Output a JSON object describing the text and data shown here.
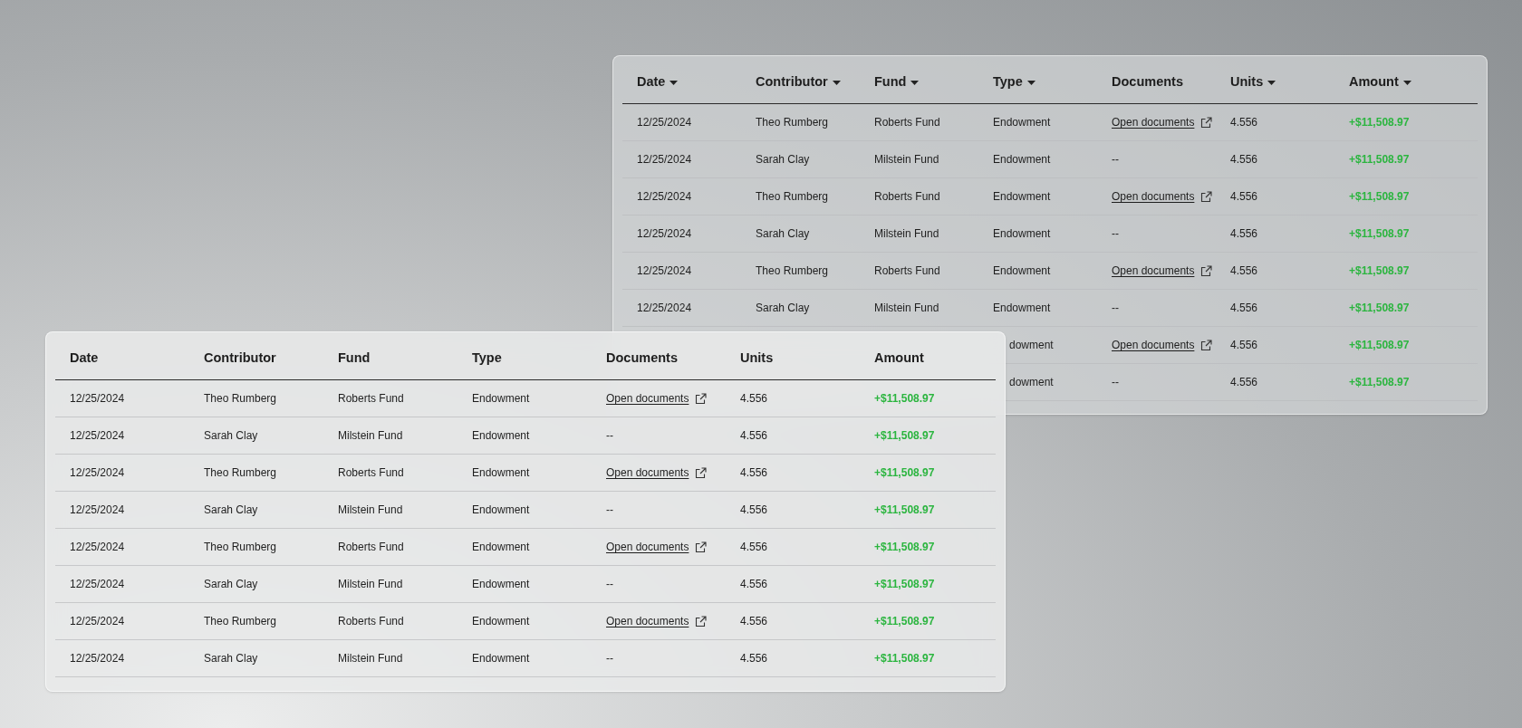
{
  "tables": [
    {
      "columns": [
        {
          "label": "Date",
          "sortable": true
        },
        {
          "label": "Contributor",
          "sortable": true
        },
        {
          "label": "Fund",
          "sortable": true
        },
        {
          "label": "Type",
          "sortable": true
        },
        {
          "label": "Documents",
          "sortable": false
        },
        {
          "label": "Units",
          "sortable": true
        },
        {
          "label": "Amount",
          "sortable": true
        }
      ],
      "rows": [
        {
          "covered": false,
          "date": "12/25/2024",
          "contributor": "Theo Rumberg",
          "fund": "Roberts Fund",
          "type": "Endowment",
          "documents": {
            "kind": "link",
            "text": "Open documents"
          },
          "units": "4.556",
          "amount": "+$11,508.97"
        },
        {
          "covered": false,
          "date": "12/25/2024",
          "contributor": "Sarah Clay",
          "fund": "Milstein Fund",
          "type": "Endowment",
          "documents": {
            "kind": "text",
            "text": "--"
          },
          "units": "4.556",
          "amount": "+$11,508.97"
        },
        {
          "covered": false,
          "date": "12/25/2024",
          "contributor": "Theo Rumberg",
          "fund": "Roberts Fund",
          "type": "Endowment",
          "documents": {
            "kind": "link",
            "text": "Open documents"
          },
          "units": "4.556",
          "amount": "+$11,508.97"
        },
        {
          "covered": false,
          "date": "12/25/2024",
          "contributor": "Sarah Clay",
          "fund": "Milstein Fund",
          "type": "Endowment",
          "documents": {
            "kind": "text",
            "text": "--"
          },
          "units": "4.556",
          "amount": "+$11,508.97"
        },
        {
          "covered": false,
          "date": "12/25/2024",
          "contributor": "Theo Rumberg",
          "fund": "Roberts Fund",
          "type": "Endowment",
          "documents": {
            "kind": "link",
            "text": "Open documents"
          },
          "units": "4.556",
          "amount": "+$11,508.97"
        },
        {
          "covered": false,
          "date": "12/25/2024",
          "contributor": "Sarah Clay",
          "fund": "Milstein Fund",
          "type": "Endowment",
          "documents": {
            "kind": "text",
            "text": "--"
          },
          "units": "4.556",
          "amount": "+$11,508.97"
        },
        {
          "covered": true,
          "type": "dowment",
          "documents": {
            "kind": "link",
            "text": "Open documents"
          },
          "units": "4.556",
          "amount": "+$11,508.97"
        },
        {
          "covered": true,
          "type": "dowment",
          "documents": {
            "kind": "text",
            "text": "--"
          },
          "units": "4.556",
          "amount": "+$11,508.97"
        }
      ]
    },
    {
      "columns": [
        {
          "label": "Date",
          "sortable": false
        },
        {
          "label": "Contributor",
          "sortable": false
        },
        {
          "label": "Fund",
          "sortable": false
        },
        {
          "label": "Type",
          "sortable": false
        },
        {
          "label": "Documents",
          "sortable": false
        },
        {
          "label": "Units",
          "sortable": false
        },
        {
          "label": "Amount",
          "sortable": false
        }
      ],
      "rows": [
        {
          "covered": false,
          "date": "12/25/2024",
          "contributor": "Theo Rumberg",
          "fund": "Roberts Fund",
          "type": "Endowment",
          "documents": {
            "kind": "link",
            "text": "Open documents"
          },
          "units": "4.556",
          "amount": "+$11,508.97"
        },
        {
          "covered": false,
          "date": "12/25/2024",
          "contributor": "Sarah Clay",
          "fund": "Milstein Fund",
          "type": "Endowment",
          "documents": {
            "kind": "text",
            "text": "--"
          },
          "units": "4.556",
          "amount": "+$11,508.97"
        },
        {
          "covered": false,
          "date": "12/25/2024",
          "contributor": "Theo Rumberg",
          "fund": "Roberts Fund",
          "type": "Endowment",
          "documents": {
            "kind": "link",
            "text": "Open documents"
          },
          "units": "4.556",
          "amount": "+$11,508.97"
        },
        {
          "covered": false,
          "date": "12/25/2024",
          "contributor": "Sarah Clay",
          "fund": "Milstein Fund",
          "type": "Endowment",
          "documents": {
            "kind": "text",
            "text": "--"
          },
          "units": "4.556",
          "amount": "+$11,508.97"
        },
        {
          "covered": false,
          "date": "12/25/2024",
          "contributor": "Theo Rumberg",
          "fund": "Roberts Fund",
          "type": "Endowment",
          "documents": {
            "kind": "link",
            "text": "Open documents"
          },
          "units": "4.556",
          "amount": "+$11,508.97"
        },
        {
          "covered": false,
          "date": "12/25/2024",
          "contributor": "Sarah Clay",
          "fund": "Milstein Fund",
          "type": "Endowment",
          "documents": {
            "kind": "text",
            "text": "--"
          },
          "units": "4.556",
          "amount": "+$11,508.97"
        },
        {
          "covered": false,
          "date": "12/25/2024",
          "contributor": "Theo Rumberg",
          "fund": "Roberts Fund",
          "type": "Endowment",
          "documents": {
            "kind": "link",
            "text": "Open documents"
          },
          "units": "4.556",
          "amount": "+$11,508.97"
        },
        {
          "covered": false,
          "date": "12/25/2024",
          "contributor": "Sarah Clay",
          "fund": "Milstein Fund",
          "type": "Endowment",
          "documents": {
            "kind": "text",
            "text": "--"
          },
          "units": "4.556",
          "amount": "+$11,508.97"
        }
      ]
    }
  ]
}
